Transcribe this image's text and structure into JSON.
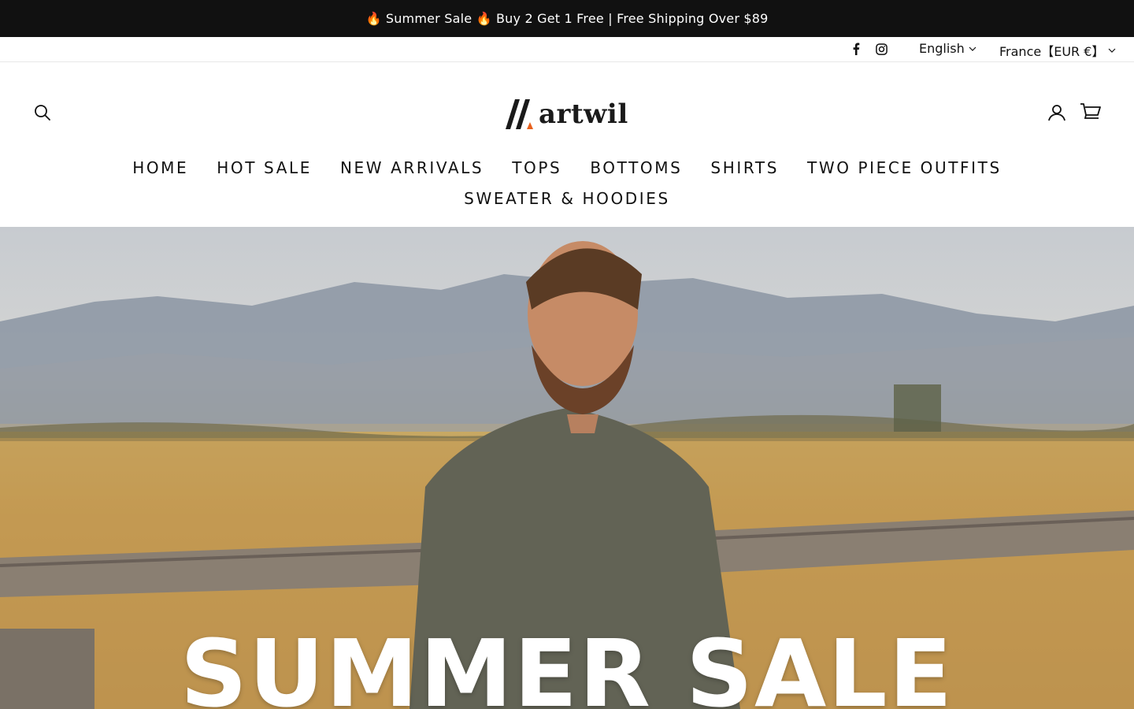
{
  "announcement": {
    "text": "🔥 Summer Sale 🔥  Buy 2 Get 1 Free | Free Shipping Over $89"
  },
  "utility": {
    "social": [
      "facebook-icon",
      "instagram-icon"
    ],
    "language": "English",
    "currency": "France【EUR €】"
  },
  "header": {
    "logo_text": "artwil",
    "icons": [
      "search-icon",
      "account-icon",
      "cart-icon"
    ]
  },
  "nav": {
    "row1": [
      "HOME",
      "HOT SALE",
      "NEW ARRIVALS",
      "TOPS",
      "BOTTOMS",
      "SHIRTS",
      "TWO PIECE OUTFITS"
    ],
    "row2": [
      "SWEATER & HOODIES"
    ]
  },
  "hero": {
    "headline": "SUMMER SALE"
  },
  "colors": {
    "announcement_bg": "#111111",
    "logo_accent": "#e8601c",
    "text": "#111111"
  }
}
